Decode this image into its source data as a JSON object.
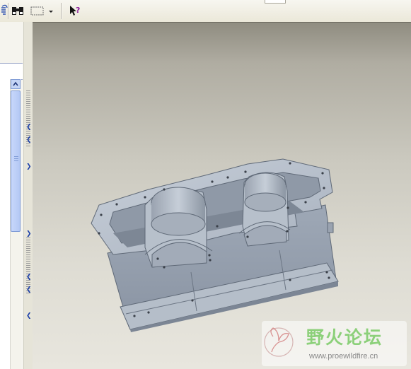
{
  "toolbar": {
    "icons": [
      "redo-icon",
      "binoculars-icon",
      "selection-box-icon",
      "dropdown-arrow-icon",
      "context-help-icon"
    ]
  },
  "model_tree": {
    "scroll_position": 0.05
  },
  "viewport": {
    "model": "gearbox-housing"
  },
  "watermark": {
    "title": "野火论坛",
    "url": "www.proewildfire.cn"
  },
  "colors": {
    "part_body": "#a9b3c1",
    "part_shadow": "#6f7a88",
    "background_top": "#8f8c80",
    "background_bottom": "#e8e6de",
    "watermark_green": "#8cd07a"
  }
}
